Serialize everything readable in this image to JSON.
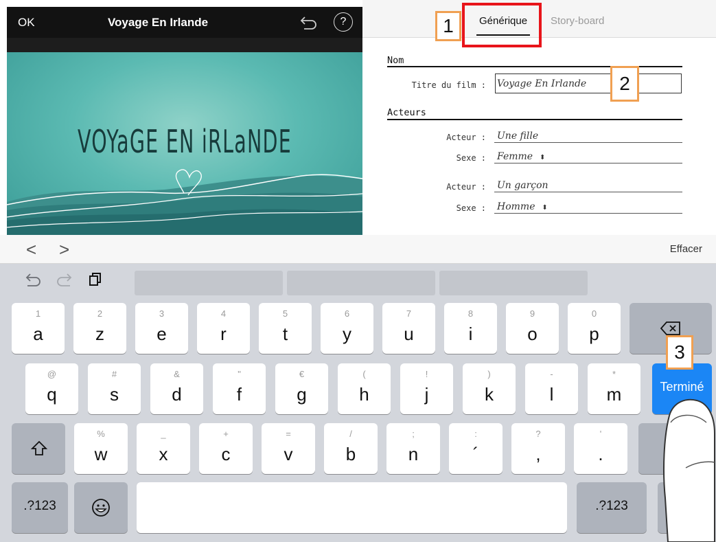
{
  "window": {
    "ok_label": "OK",
    "title": "Voyage En Irlande"
  },
  "poster": {
    "title": "VOYaGE EN iRLaNDE"
  },
  "tabs": {
    "generique": "Générique",
    "storyboard": "Story-board"
  },
  "callouts": {
    "one": "1",
    "two": "2",
    "three": "3"
  },
  "form": {
    "section_nom": "Nom",
    "film_title_label": "Titre du film :",
    "film_title_value": "Voyage En Irlande",
    "section_acteurs": "Acteurs",
    "actors": [
      {
        "actor_label": "Acteur :",
        "actor_value": "Une fille",
        "sex_label": "Sexe :",
        "sex_value": "Femme"
      },
      {
        "actor_label": "Acteur :",
        "actor_value": "Un garçon",
        "sex_label": "Sexe :",
        "sex_value": "Homme"
      }
    ]
  },
  "accessory": {
    "back_symbol": "<",
    "forward_symbol": ">",
    "erase_label": "Effacer"
  },
  "keyboard": {
    "row1": [
      {
        "sub": "1",
        "main": "a"
      },
      {
        "sub": "2",
        "main": "z"
      },
      {
        "sub": "3",
        "main": "e"
      },
      {
        "sub": "4",
        "main": "r"
      },
      {
        "sub": "5",
        "main": "t"
      },
      {
        "sub": "6",
        "main": "y"
      },
      {
        "sub": "7",
        "main": "u"
      },
      {
        "sub": "8",
        "main": "i"
      },
      {
        "sub": "9",
        "main": "o"
      },
      {
        "sub": "0",
        "main": "p"
      }
    ],
    "row2": [
      {
        "sub": "@",
        "main": "q"
      },
      {
        "sub": "#",
        "main": "s"
      },
      {
        "sub": "&",
        "main": "d"
      },
      {
        "sub": "\"",
        "main": "f"
      },
      {
        "sub": "€",
        "main": "g"
      },
      {
        "sub": "(",
        "main": "h"
      },
      {
        "sub": "!",
        "main": "j"
      },
      {
        "sub": ")",
        "main": "k"
      },
      {
        "sub": "-",
        "main": "l"
      },
      {
        "sub": "*",
        "main": "m"
      }
    ],
    "done_label": "Terminé",
    "row3": [
      {
        "sub": "%",
        "main": "w"
      },
      {
        "sub": "_",
        "main": "x"
      },
      {
        "sub": "+",
        "main": "c"
      },
      {
        "sub": "=",
        "main": "v"
      },
      {
        "sub": "/",
        "main": "b"
      },
      {
        "sub": ";",
        "main": "n"
      },
      {
        "sub": ":",
        "main": "´"
      },
      {
        "sub": "?",
        "main": ","
      },
      {
        "sub": "'",
        "main": "."
      }
    ],
    "numbers_label": ".?123"
  }
}
